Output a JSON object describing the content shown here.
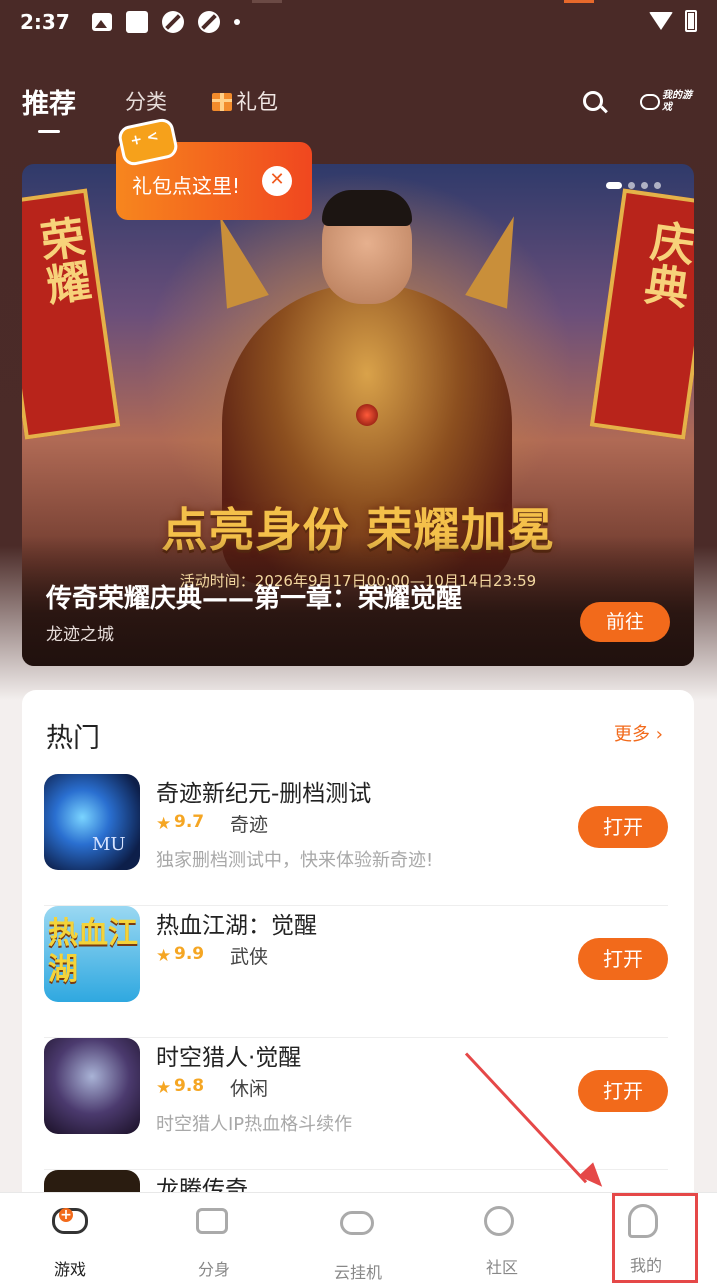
{
  "status_bar": {
    "time": "2:37"
  },
  "nav": {
    "tabs": [
      {
        "label": "推荐"
      },
      {
        "label": "分类"
      },
      {
        "label": "礼包"
      }
    ],
    "my_games_label": "我的游戏"
  },
  "tooltip": {
    "text": "礼包点这里!",
    "close": "✕"
  },
  "banner": {
    "flag_left": "荣耀",
    "flag_right": "庆典",
    "slogan": "点亮身份 荣耀加冕",
    "activity_time": "活动时间：2026年9月17日00:00—10月14日23:59",
    "title": "传奇荣耀庆典——第一章：荣耀觉醒",
    "subtitle": "龙迹之城",
    "go_button": "前往"
  },
  "hot": {
    "title": "热门",
    "more": "更多 ›",
    "games": [
      {
        "name": "奇迹新纪元-删档测试",
        "score": "9.7",
        "tag": "奇迹",
        "desc": "独家删档测试中，快来体验新奇迹!",
        "button": "打开",
        "icon_text": "MU"
      },
      {
        "name": "热血江湖：觉醒",
        "score": "9.9",
        "tag": "武侠",
        "desc": "",
        "button": "打开",
        "icon_text": "热血江湖"
      },
      {
        "name": "时空猎人·觉醒",
        "score": "9.8",
        "tag": "休闲",
        "desc": "时空猎人IP热血格斗续作",
        "button": "打开",
        "icon_text": ""
      },
      {
        "name": "龙腾传奇",
        "score": "",
        "tag": "",
        "desc": "",
        "button": "",
        "icon_text": ""
      }
    ]
  },
  "bottom_nav": {
    "items": [
      {
        "label": "游戏",
        "icon": "gamepad-icon"
      },
      {
        "label": "分身",
        "icon": "clone-icon"
      },
      {
        "label": "云挂机",
        "icon": "cloud-clock-icon"
      },
      {
        "label": "社区",
        "icon": "planet-icon"
      },
      {
        "label": "我的",
        "icon": "profile-icon"
      }
    ]
  },
  "colors": {
    "accent": "#f26a1b",
    "header_bg": "#4a2a27",
    "annotation": "#e54848"
  }
}
